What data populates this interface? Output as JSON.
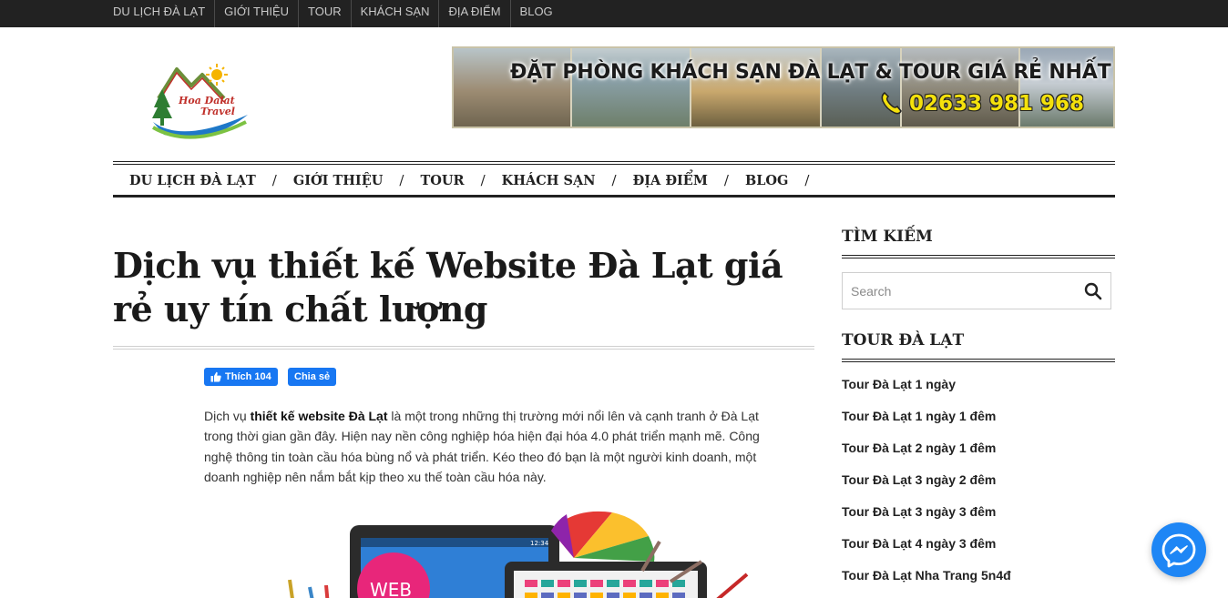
{
  "topbar": {
    "items": [
      "DU LỊCH ĐÀ LẠT",
      "GIỚI THIỆU",
      "TOUR",
      "KHÁCH SẠN",
      "ĐỊA ĐIỂM",
      "BLOG"
    ]
  },
  "logo": {
    "text_line1": "Hoa Dalat",
    "text_line2": "Travel"
  },
  "banner": {
    "headline": "ĐẶT PHÒNG KHÁCH SẠN ĐÀ LẠT & TOUR GIÁ RẺ NHẤT",
    "phone": "02633 981 968"
  },
  "mainnav": {
    "items": [
      "DU LỊCH ĐÀ LẠT",
      "GIỚI THIỆU",
      "TOUR",
      "KHÁCH SẠN",
      "ĐỊA ĐIỂM",
      "BLOG"
    ],
    "separator": "/"
  },
  "article": {
    "title": "Dịch vụ thiết kế Website Đà Lạt giá rẻ uy tín chất lượng",
    "fb_like": "Thích 104",
    "fb_share": "Chia sẻ",
    "intro_prefix": "Dịch vụ ",
    "intro_bold": "thiết kế  website Đà Lạt",
    "intro_rest": " là một trong những thị trường mới nổi lên và cạnh tranh ở Đà Lạt trong thời gian gần đây. Hiện nay nền công nghiệp hóa hiện đại hóa 4.0 phát triển mạnh mẽ. Công nghệ thông tin toàn cầu hóa bùng nổ và phát triển. Kéo theo đó bạn là một người kinh doanh, một doanh nghiệp nên nắm bắt kịp theo xu thế toàn cầu hóa này.",
    "image_word": "WEB",
    "tablet_time": "12:34"
  },
  "sidebar": {
    "search_heading": "TÌM KIẾM",
    "search_placeholder": "Search",
    "tour_heading": "TOUR ĐÀ LẠT",
    "tours": [
      "Tour Đà Lạt 1 ngày",
      "Tour Đà Lạt 1 ngày 1 đêm",
      "Tour Đà Lạt 2 ngày 1 đêm",
      "Tour Đà Lạt 3 ngày 2 đêm",
      "Tour Đà Lạt 3 ngày 3 đêm",
      "Tour Đà Lạt 4 ngày 3 đêm",
      "Tour Đà Lạt Nha Trang 5n4đ"
    ]
  },
  "colors": {
    "topbar_bg": "#222222",
    "facebook_blue": "#1877f2",
    "messenger_blue": "#1e86f5",
    "phone_yellow": "#f4e10c"
  },
  "icons": {
    "search": "search-icon",
    "messenger": "messenger-icon",
    "like": "thumbs-up-icon",
    "phone": "phone-icon"
  }
}
